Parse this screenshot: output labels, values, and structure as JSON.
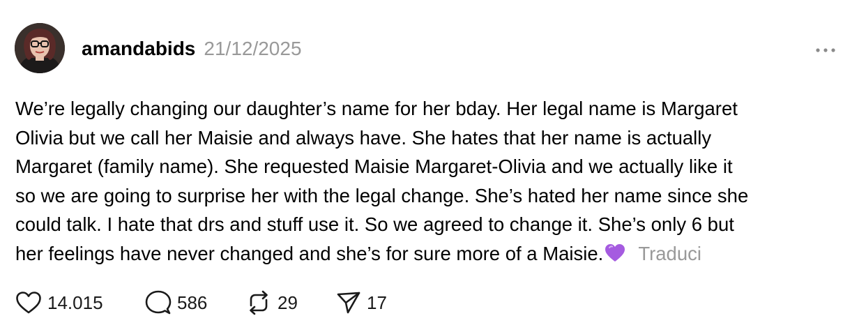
{
  "post": {
    "username": "amandabids",
    "date": "21/12/2025",
    "text_lines": [
      "We’re legally changing our daughter’s name for her bday. Her legal name is Margaret",
      "Olivia but we call her Maisie and always have. She hates that her name is actually",
      "Margaret (family name). She requested Maisie Margaret-Olivia and we actually like it",
      "so we are going to surprise her with the legal change. She’s hated her name since she",
      "could talk. I hate that drs and stuff use it. So we agreed to change it. She’s only 6 but",
      "her feelings have never changed and she’s for sure more of a Maisie."
    ],
    "emoji": "purple-heart-emoji",
    "translate_label": "Traduci"
  },
  "actions": {
    "likes": "14.015",
    "comments": "586",
    "reposts": "29",
    "shares": "17"
  },
  "icons": {
    "more": "more-options-icon",
    "like": "heart-outline-icon",
    "comment": "speech-bubble-icon",
    "repost": "repost-arrows-icon",
    "share": "send-paper-plane-icon"
  },
  "colors": {
    "text": "#000000",
    "muted": "#999999",
    "icon": "#1a1a1a",
    "emoji": "#a55be0",
    "background": "#ffffff"
  }
}
